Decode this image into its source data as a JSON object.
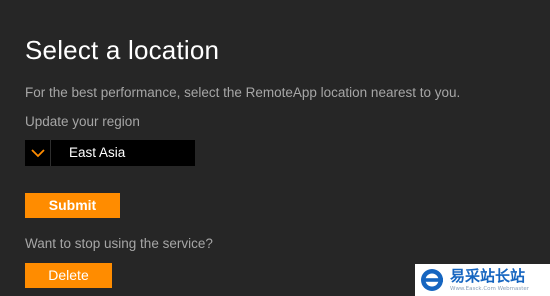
{
  "page": {
    "title": "Select a location",
    "description": "For the best performance, select the RemoteApp location nearest to you.",
    "region_label": "Update your region"
  },
  "region_select": {
    "selected_value": "East Asia",
    "chevron_icon": "chevron-down-icon"
  },
  "actions": {
    "submit_label": "Submit",
    "stop_question": "Want to stop using the service?",
    "delete_label": "Delete"
  },
  "watermark": {
    "text_cn": "易采站长站",
    "text_en": "Www.Easck.Com Webmaster",
    "logo_icon": "easck-logo-icon"
  },
  "colors": {
    "background": "#262626",
    "accent": "#ff8c00",
    "muted_text": "#a6a6a6",
    "select_background": "#000000"
  }
}
